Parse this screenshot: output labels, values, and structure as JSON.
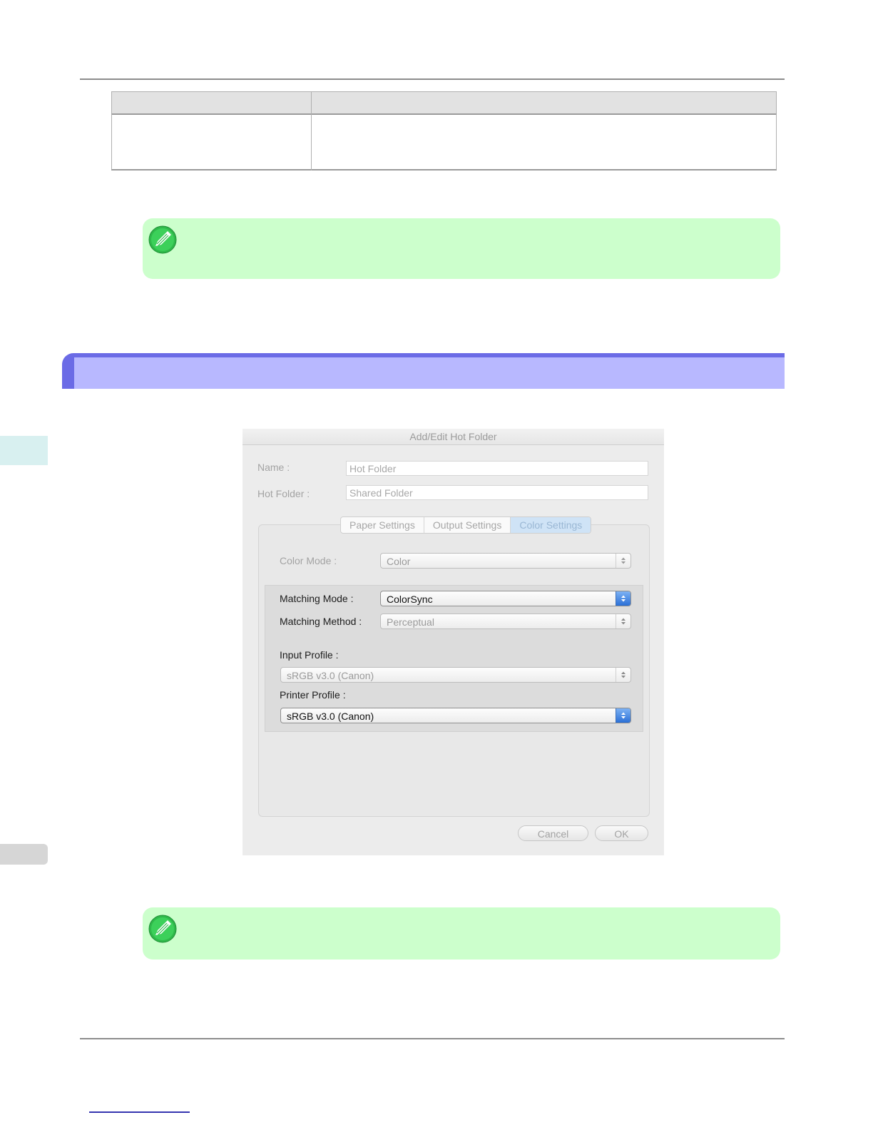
{
  "dialog": {
    "title": "Add/Edit Hot Folder",
    "name_label": "Name :",
    "name_value": "Hot Folder",
    "hot_folder_label": "Hot Folder :",
    "hot_folder_value": "Shared Folder",
    "tabs": [
      {
        "label": "Paper Settings"
      },
      {
        "label": "Output Settings"
      },
      {
        "label": "Color Settings"
      }
    ],
    "active_tab": "Color Settings",
    "color_mode_label": "Color Mode :",
    "color_mode_value": "Color",
    "matching_mode_label": "Matching Mode :",
    "matching_mode_value": "ColorSync",
    "matching_method_label": "Matching Method :",
    "matching_method_value": "Perceptual",
    "input_profile_label": "Input Profile :",
    "input_profile_value": "sRGB v3.0 (Canon)",
    "printer_profile_label": "Printer Profile :",
    "printer_profile_value": "sRGB v3.0 (Canon)",
    "cancel_label": "Cancel",
    "ok_label": "OK"
  },
  "colors": {
    "note_bg": "#ccffcc",
    "band_dark": "#6b6be6",
    "band_light": "#b8b8ff",
    "popup_accent": "#2b6fd6"
  },
  "icons": [
    "note-pencil-icon",
    "chevron-updown-icon"
  ]
}
